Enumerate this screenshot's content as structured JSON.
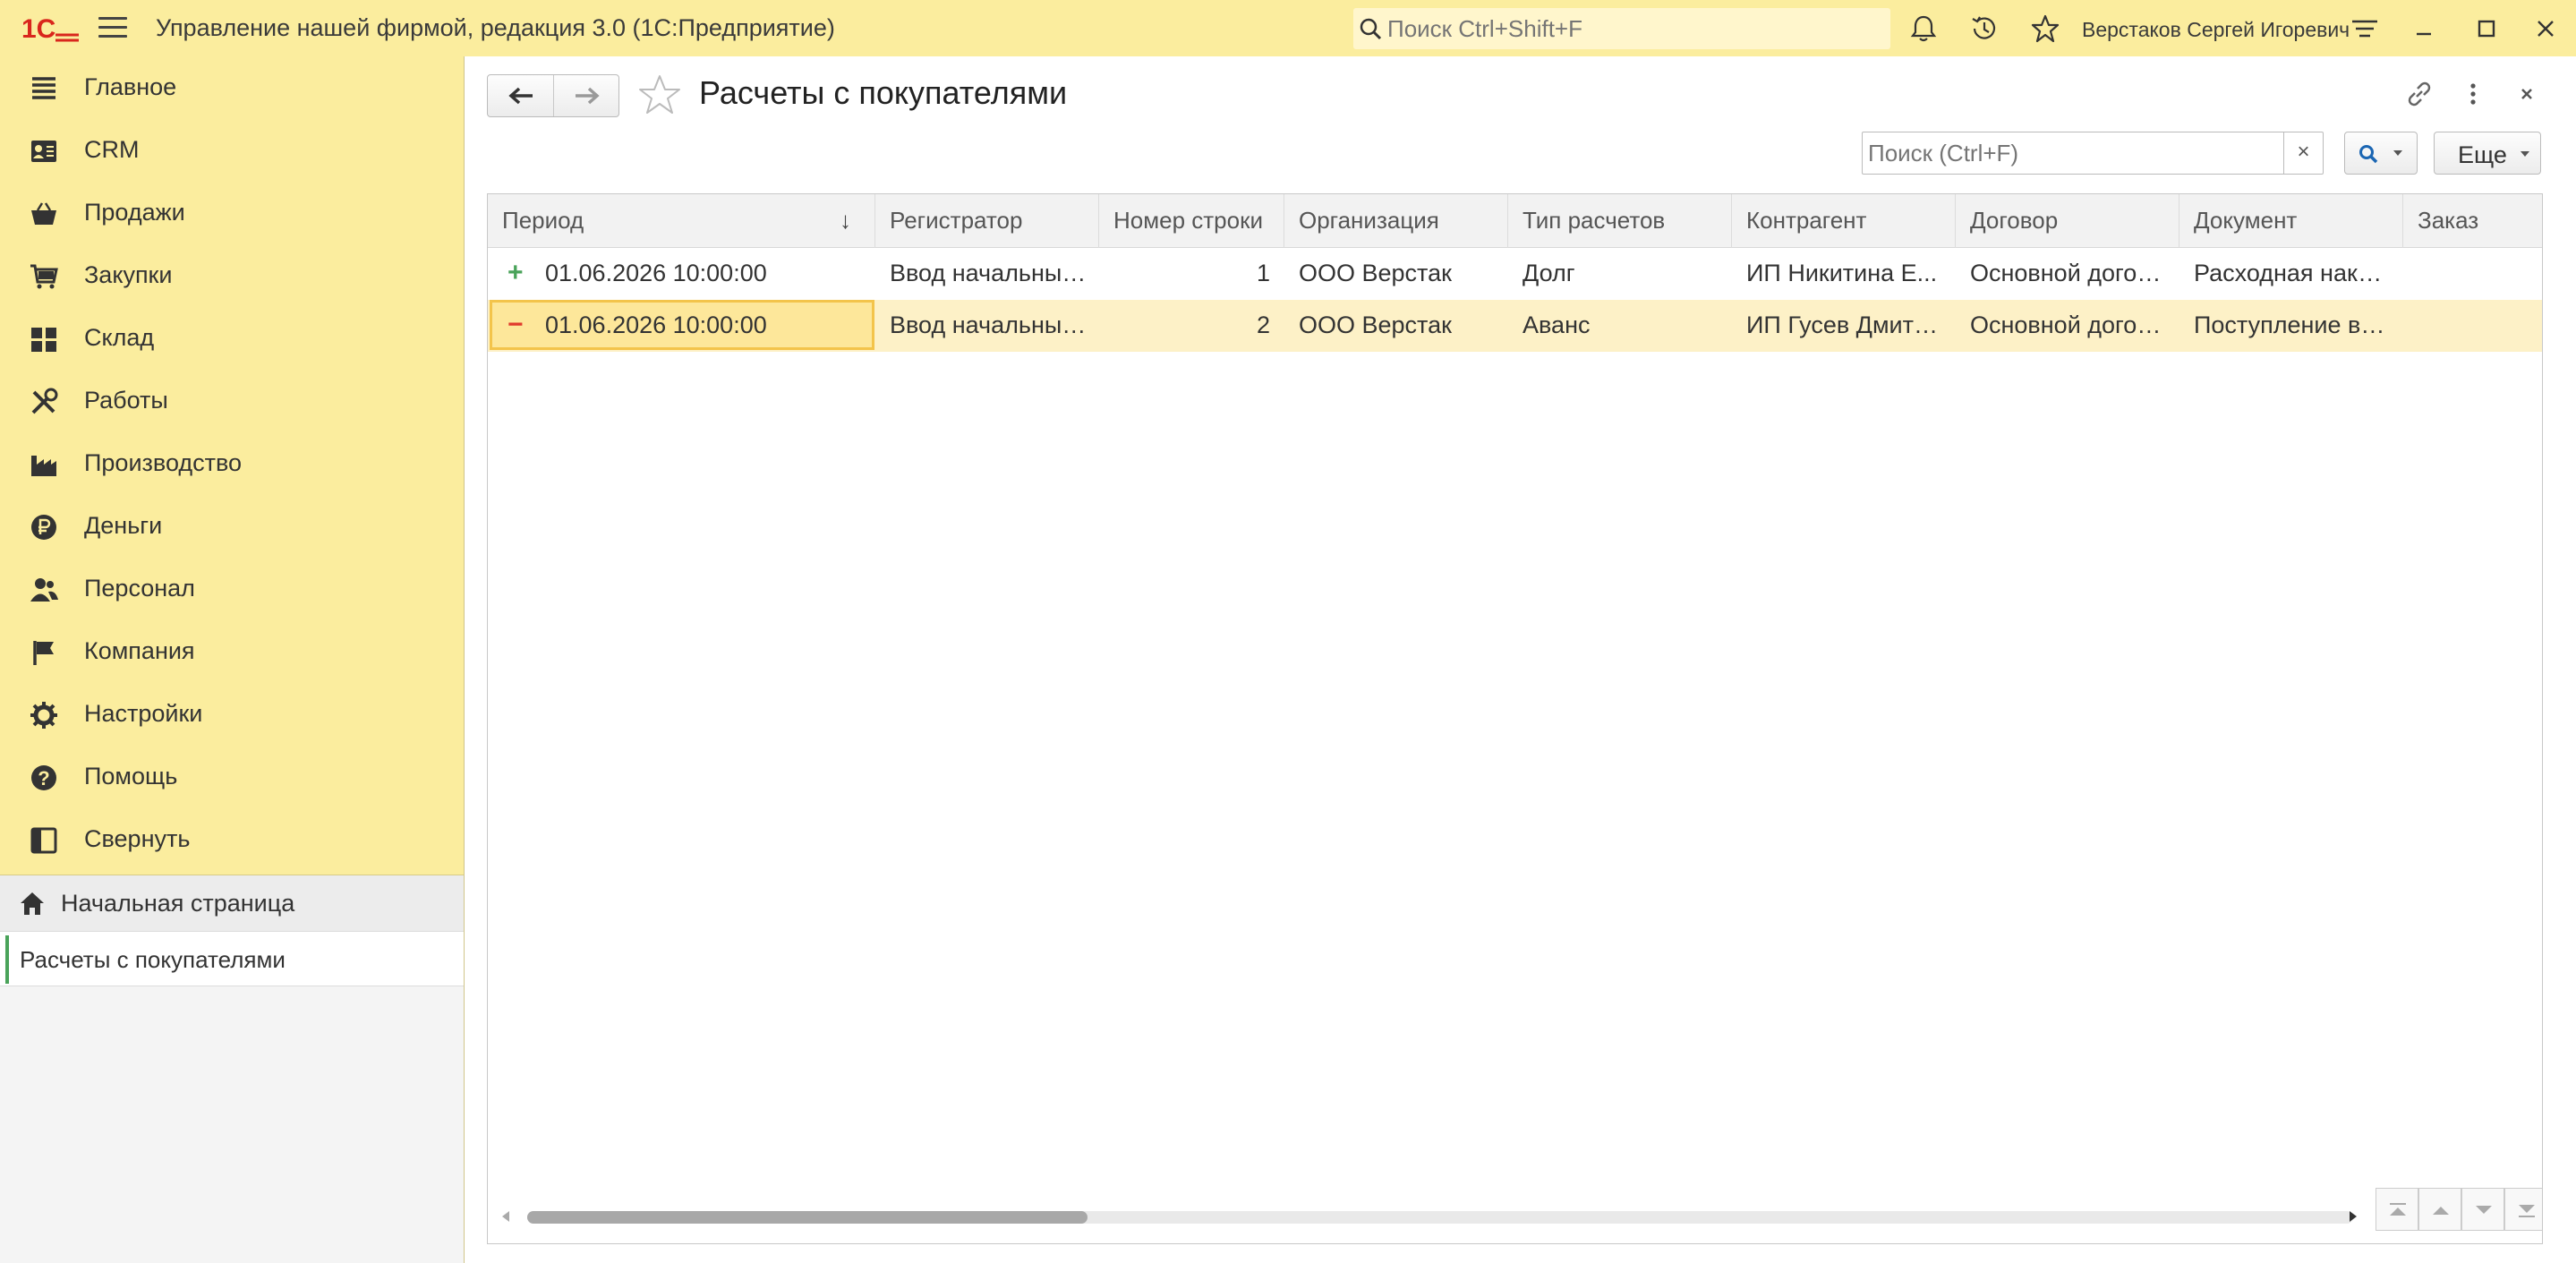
{
  "app": {
    "title": "Управление нашей фирмой, редакция 3.0  (1С:Предприятие)",
    "search_placeholder": "Поиск Ctrl+Shift+F",
    "user": "Верстаков Сергей Игоревич",
    "brand_color": "#fbed9e"
  },
  "sidebar": {
    "items": [
      {
        "label": "Главное",
        "icon": "list-icon"
      },
      {
        "label": "CRM",
        "icon": "crm-icon"
      },
      {
        "label": "Продажи",
        "icon": "basket-icon"
      },
      {
        "label": "Закупки",
        "icon": "cart-icon"
      },
      {
        "label": "Склад",
        "icon": "warehouse-icon"
      },
      {
        "label": "Работы",
        "icon": "tools-icon"
      },
      {
        "label": "Производство",
        "icon": "factory-icon"
      },
      {
        "label": "Деньги",
        "icon": "ruble-icon"
      },
      {
        "label": "Персонал",
        "icon": "people-icon"
      },
      {
        "label": "Компания",
        "icon": "flag-icon"
      },
      {
        "label": "Настройки",
        "icon": "gear-icon"
      },
      {
        "label": "Помощь",
        "icon": "help-icon"
      },
      {
        "label": "Свернуть",
        "icon": "collapse-icon"
      }
    ],
    "open_windows": {
      "home": "Начальная страница",
      "current": "Расчеты с покупателями"
    }
  },
  "form": {
    "title": "Расчеты с покупателями",
    "search_placeholder": "Поиск (Ctrl+F)",
    "clear_label": "×",
    "more_label": "Еще"
  },
  "table": {
    "columns": [
      "Период",
      "Регистратор",
      "Номер строки",
      "Организация",
      "Тип расчетов",
      "Контрагент",
      "Договор",
      "Документ",
      "Заказ"
    ],
    "sorted_column": "Период",
    "sort_direction": "descending",
    "sort_glyph": "↓",
    "rows": [
      {
        "sign": "+",
        "period": "01.06.2026 10:00:00",
        "registrar": "Ввод начальных остатков",
        "line_no": "1",
        "org": "ООО Верстак",
        "calc_type": "Долг",
        "counterparty": "ИП Никитина Е...",
        "contract": "Основной договор",
        "document": "Расходная накладная",
        "order": ""
      },
      {
        "sign": "−",
        "period": "01.06.2026 10:00:00",
        "registrar": "Ввод начальных остатков",
        "line_no": "2",
        "org": "ООО Верстак",
        "calc_type": "Аванс",
        "counterparty": "ИП Гусев Дмитрий",
        "contract": "Основной договор",
        "document": "Поступление в кассу",
        "order": ""
      }
    ],
    "selected_row": 1,
    "scroll_fraction": 0.0
  }
}
